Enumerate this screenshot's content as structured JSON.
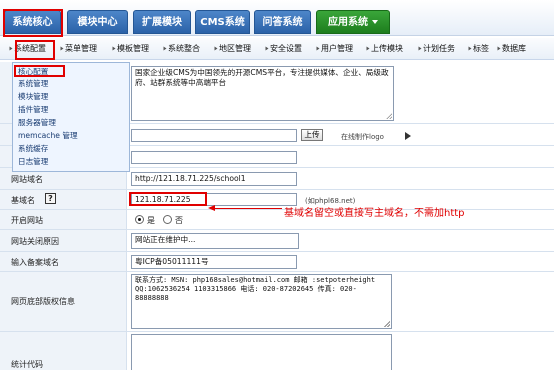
{
  "top_tabs": [
    {
      "label": "系统核心"
    },
    {
      "label": "模块中心"
    },
    {
      "label": "扩展模块"
    },
    {
      "label": "CMS系统"
    },
    {
      "label": "问答系统"
    },
    {
      "label": "应用系统"
    }
  ],
  "sub_nav": [
    {
      "label": "系统配置"
    },
    {
      "label": "菜单管理"
    },
    {
      "label": "模板管理"
    },
    {
      "label": "系统整合"
    },
    {
      "label": "地区管理"
    },
    {
      "label": "安全设置"
    },
    {
      "label": "用户管理"
    },
    {
      "label": "上传模块"
    },
    {
      "label": "计划任务"
    },
    {
      "label": "标签"
    },
    {
      "label": "数据库"
    }
  ],
  "dropdown": [
    {
      "label": "核心配置"
    },
    {
      "label": "系统管理"
    },
    {
      "label": "模块管理"
    },
    {
      "label": "插件管理"
    },
    {
      "label": "服务器管理"
    },
    {
      "label": "memcache 管理"
    },
    {
      "label": "系统缓存"
    },
    {
      "label": "日志管理"
    }
  ],
  "form": {
    "site_desc": "国家企业级CMS为中国领先的开源CMS平台，专注提供媒体、企业、局级政府、站群系统等中高端平台",
    "upload_button": "上传",
    "online_logo": "在线制作logo",
    "site_domain_label": "网站域名",
    "site_domain_value": "http://121.18.71.225/school1",
    "base_domain_label": "基域名",
    "help_mark": "?",
    "base_domain_value": "121.18.71.225",
    "base_domain_hint": "(如phpl68.net)",
    "annotation": "基域名留空或直接写主域名，不需加http",
    "open_site_label": "开启网站",
    "radio_yes": "是",
    "radio_no": "否",
    "close_reason_label": "网站关闭原因",
    "close_reason_value": "网站正在维护中...",
    "icp_label": "输入备案域名",
    "icp_value": "粤ICP备05011111号",
    "footer_label": "网页底部版权信息",
    "footer_value": "联系方式: MSN: php168sales@hotmail.com 邮箱 :setpoterheight QQ:1062536254 1103315866 电话: 020-87202645 传真: 020-88888888",
    "stats_label": "统计代码"
  }
}
